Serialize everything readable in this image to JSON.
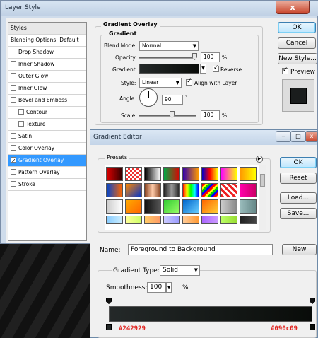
{
  "layer_style": {
    "title": "Layer Style",
    "close_glyph": "x",
    "styles_list": [
      {
        "label": "Styles",
        "checkbox": false,
        "selected": false,
        "indent": false
      },
      {
        "label": "Blending Options: Default",
        "checkbox": false,
        "selected": false,
        "indent": false
      },
      {
        "label": "Drop Shadow",
        "checkbox": true,
        "checked": false,
        "selected": false,
        "indent": false
      },
      {
        "label": "Inner Shadow",
        "checkbox": true,
        "checked": false,
        "selected": false,
        "indent": false
      },
      {
        "label": "Outer Glow",
        "checkbox": true,
        "checked": false,
        "selected": false,
        "indent": false
      },
      {
        "label": "Inner Glow",
        "checkbox": true,
        "checked": false,
        "selected": false,
        "indent": false
      },
      {
        "label": "Bevel and Emboss",
        "checkbox": true,
        "checked": false,
        "selected": false,
        "indent": false
      },
      {
        "label": "Contour",
        "checkbox": true,
        "checked": false,
        "selected": false,
        "indent": true
      },
      {
        "label": "Texture",
        "checkbox": true,
        "checked": false,
        "selected": false,
        "indent": true
      },
      {
        "label": "Satin",
        "checkbox": true,
        "checked": false,
        "selected": false,
        "indent": false
      },
      {
        "label": "Color Overlay",
        "checkbox": true,
        "checked": false,
        "selected": false,
        "indent": false
      },
      {
        "label": "Gradient Overlay",
        "checkbox": true,
        "checked": true,
        "selected": true,
        "indent": false
      },
      {
        "label": "Pattern Overlay",
        "checkbox": true,
        "checked": false,
        "selected": false,
        "indent": false
      },
      {
        "label": "Stroke",
        "checkbox": true,
        "checked": false,
        "selected": false,
        "indent": false
      }
    ],
    "section_title": "Gradient Overlay",
    "group_title": "Gradient",
    "blend_mode_label": "Blend Mode:",
    "blend_mode_value": "Normal",
    "opacity_label": "Opacity:",
    "opacity_value": "100",
    "opacity_unit": "%",
    "opacity_level": 1.0,
    "gradient_label": "Gradient:",
    "reverse_label": "Reverse",
    "reverse_checked": true,
    "style_label": "Style:",
    "style_value": "Linear",
    "align_label": "Align with Layer",
    "align_checked": true,
    "angle_label": "Angle:",
    "angle_value": "90",
    "angle_unit": "°",
    "scale_label": "Scale:",
    "scale_value": "100",
    "scale_unit": "%",
    "scale_level": 0.67,
    "buttons": {
      "ok": "OK",
      "cancel": "Cancel",
      "new_style": "New Style..."
    },
    "preview_label": "Preview",
    "preview_checked": true
  },
  "gradient_editor": {
    "title": "Gradient Editor",
    "presets_label": "Presets",
    "buttons": {
      "ok": "OK",
      "reset": "Reset",
      "load": "Load...",
      "save": "Save...",
      "new": "New"
    },
    "name_label": "Name:",
    "name_value": "Foreground to Background",
    "gradient_type_label": "Gradient Type:",
    "gradient_type_value": "Solid",
    "smoothness_label": "Smoothness:",
    "smoothness_value": "100",
    "smoothness_unit": "%",
    "stop_left_color": "#242929",
    "stop_right_color": "#090c09",
    "colors": {
      "left": "#242929",
      "right": "#090c09",
      "accent": "#3399ff"
    }
  }
}
